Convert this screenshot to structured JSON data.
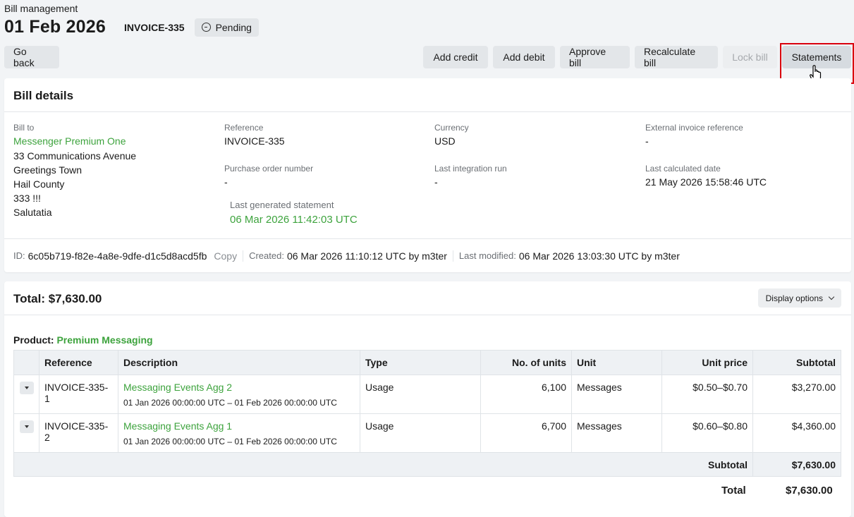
{
  "header": {
    "breadcrumb": "Bill management",
    "date": "01 Feb 2026",
    "invoice_code": "INVOICE-335",
    "status": "Pending"
  },
  "toolbar": {
    "go_back": "Go back",
    "add_credit": "Add credit",
    "add_debit": "Add debit",
    "approve_bill": "Approve bill",
    "recalculate_bill": "Recalculate bill",
    "lock_bill": "Lock bill",
    "statements": "Statements"
  },
  "bill_details": {
    "title": "Bill details",
    "bill_to_label": "Bill to",
    "bill_to_name": "Messenger Premium One",
    "address": [
      "33 Communications Avenue",
      "Greetings Town",
      "Hail County",
      "333 !!!",
      "Salutatia"
    ],
    "reference_label": "Reference",
    "reference": "INVOICE-335",
    "po_label": "Purchase order number",
    "po": "-",
    "currency_label": "Currency",
    "currency": "USD",
    "last_integration_label": "Last integration run",
    "last_integration": "-",
    "ext_ref_label": "External invoice reference",
    "ext_ref": "-",
    "last_calc_label": "Last calculated date",
    "last_calc": "21 May 2026 15:58:46 UTC",
    "last_statement_label": "Last generated statement",
    "last_statement": "06 Mar 2026 11:42:03 UTC",
    "id_label": "ID:",
    "id": "6c05b719-f82e-4a8e-9dfe-d1c5d8acd5fb",
    "copy": "Copy",
    "created_label": "Created:",
    "created": "06 Mar 2026 11:10:12 UTC by m3ter",
    "modified_label": "Last modified:",
    "modified": "06 Mar 2026 13:03:30 UTC by m3ter"
  },
  "totals": {
    "title": "Total: $7,630.00",
    "display_options": "Display options",
    "product_label": "Product:",
    "product_name": "Premium Messaging",
    "columns": [
      "Reference",
      "Description",
      "Type",
      "No. of units",
      "Unit",
      "Unit price",
      "Subtotal"
    ],
    "rows": [
      {
        "reference": "INVOICE-335-1",
        "description": "Messaging Events Agg 2",
        "period": "01 Jan 2026 00:00:00 UTC – 01 Feb 2026 00:00:00 UTC",
        "type": "Usage",
        "units": "6,100",
        "unit": "Messages",
        "unit_price": "$0.50–$0.70",
        "subtotal": "$3,270.00"
      },
      {
        "reference": "INVOICE-335-2",
        "description": "Messaging Events Agg 1",
        "period": "01 Jan 2026 00:00:00 UTC – 01 Feb 2026 00:00:00 UTC",
        "type": "Usage",
        "units": "6,700",
        "unit": "Messages",
        "unit_price": "$0.60–$0.80",
        "subtotal": "$4,360.00"
      }
    ],
    "subtotal_label": "Subtotal",
    "subtotal_value": "$7,630.00",
    "total_label": "Total",
    "total_value": "$7,630.00"
  }
}
